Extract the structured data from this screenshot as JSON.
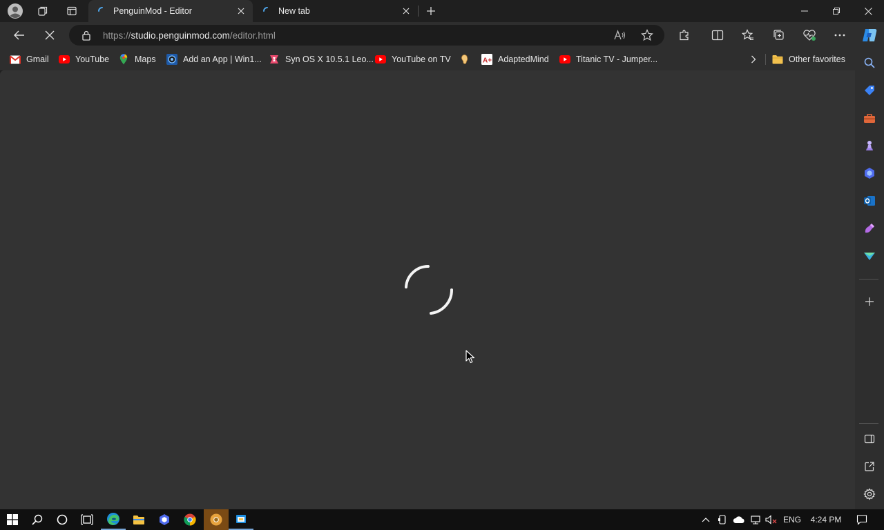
{
  "tabs": [
    {
      "title": "PenguinMod - Editor",
      "active": true
    },
    {
      "title": "New tab",
      "active": false
    }
  ],
  "address": {
    "scheme": "https://",
    "host": "studio.penguinmod.com",
    "path": "/editor.html"
  },
  "favorites": [
    {
      "label": "Gmail",
      "icon": "gmail-icon"
    },
    {
      "label": "YouTube",
      "icon": "youtube-icon"
    },
    {
      "label": "Maps",
      "icon": "maps-icon"
    },
    {
      "label": "Add an App | Win1...",
      "icon": "app-icon"
    },
    {
      "label": "Syn OS X 10.5.1 Leo...",
      "icon": "syn-icon"
    },
    {
      "label": "YouTube on TV",
      "icon": "youtube-icon"
    },
    {
      "label": "",
      "icon": "ear-icon"
    },
    {
      "label": "AdaptedMind",
      "icon": "adaptedmind-icon"
    },
    {
      "label": "Titanic TV - Jumper...",
      "icon": "youtube-icon"
    }
  ],
  "other_favorites": "Other favorites",
  "taskbar": {
    "language": "ENG",
    "time": "4:24 PM"
  },
  "colors": {
    "accent": "#79a6d6",
    "youtube_red": "#ff0000",
    "page_bg": "#333333",
    "chrome_bg": "#2e2e2e"
  }
}
